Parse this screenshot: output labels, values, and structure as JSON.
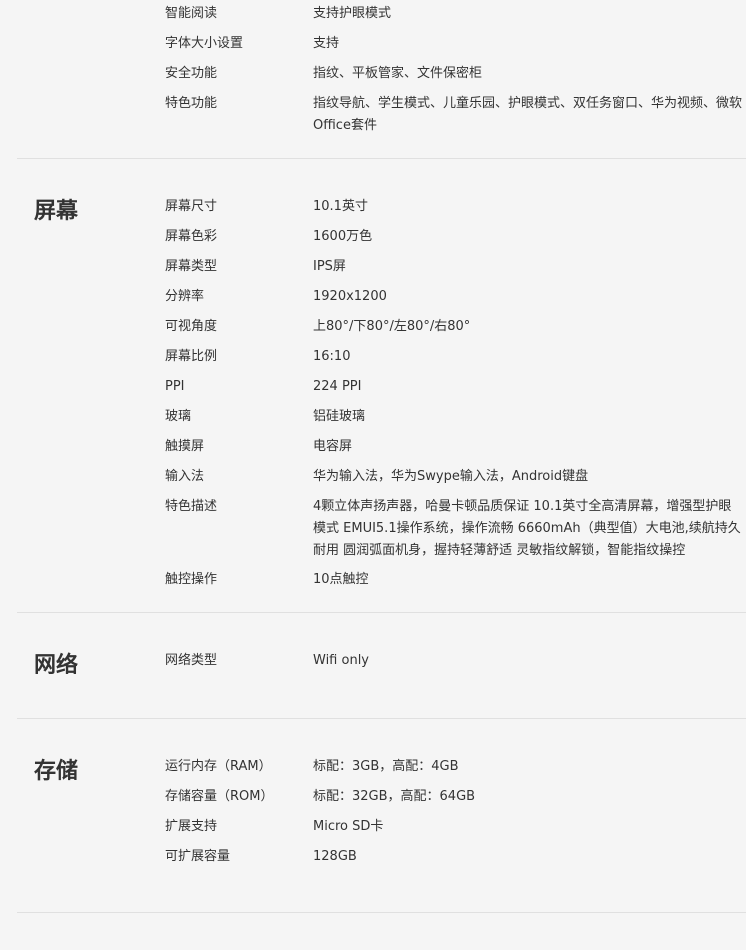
{
  "sections": [
    {
      "title": "",
      "rows": [
        {
          "label": "智能阅读",
          "value": "支持护眼模式"
        },
        {
          "label": "字体大小设置",
          "value": "支持"
        },
        {
          "label": "安全功能",
          "value": "指纹、平板管家、文件保密柜"
        },
        {
          "label": "特色功能",
          "value": "指纹导航、学生模式、儿童乐园、护眼模式、双任务窗口、华为视频、微软Office套件"
        }
      ]
    },
    {
      "title": "屏幕",
      "rows": [
        {
          "label": "屏幕尺寸",
          "value": "10.1英寸"
        },
        {
          "label": "屏幕色彩",
          "value": "1600万色"
        },
        {
          "label": "屏幕类型",
          "value": "IPS屏"
        },
        {
          "label": "分辨率",
          "value": "1920x1200"
        },
        {
          "label": "可视角度",
          "value": "上80°/下80°/左80°/右80°"
        },
        {
          "label": "屏幕比例",
          "value": "16:10"
        },
        {
          "label": "PPI",
          "value": "224 PPI"
        },
        {
          "label": "玻璃",
          "value": "铝硅玻璃"
        },
        {
          "label": "触摸屏",
          "value": "电容屏"
        },
        {
          "label": "输入法",
          "value": "华为输入法，华为Swype输入法，Android键盘"
        },
        {
          "label": "特色描述",
          "value": "4颗立体声扬声器，哈曼卡顿品质保证 10.1英寸全高清屏幕，增强型护眼模式 EMUI5.1操作系统，操作流畅 6660mAh（典型值）大电池,续航持久耐用 圆润弧面机身，握持轻薄舒适 灵敏指纹解锁，智能指纹操控"
        },
        {
          "label": "触控操作",
          "value": "10点触控"
        }
      ]
    },
    {
      "title": "网络",
      "rows": [
        {
          "label": "网络类型",
          "value": "Wifi only"
        }
      ]
    },
    {
      "title": "存储",
      "rows": [
        {
          "label": "运行内存（RAM）",
          "value": "标配：3GB，高配：4GB"
        },
        {
          "label": "存储容量（ROM）",
          "value": "标配：32GB，高配：64GB"
        },
        {
          "label": "扩展支持",
          "value": "Micro SD卡"
        },
        {
          "label": "可扩展容量",
          "value": "128GB"
        }
      ]
    }
  ]
}
